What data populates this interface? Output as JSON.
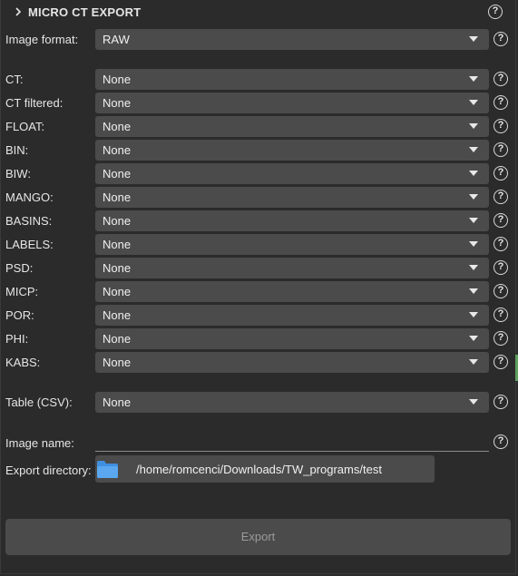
{
  "header": {
    "title": "MICRO CT EXPORT"
  },
  "image_format": {
    "label": "Image format:",
    "value": "RAW"
  },
  "volumes": [
    {
      "label": "CT:",
      "value": "None"
    },
    {
      "label": "CT filtered:",
      "value": "None"
    },
    {
      "label": "FLOAT:",
      "value": "None"
    },
    {
      "label": "BIN:",
      "value": "None"
    },
    {
      "label": "BIW:",
      "value": "None"
    },
    {
      "label": "MANGO:",
      "value": "None"
    },
    {
      "label": "BASINS:",
      "value": "None"
    },
    {
      "label": "LABELS:",
      "value": "None"
    },
    {
      "label": "PSD:",
      "value": "None"
    },
    {
      "label": "MICP:",
      "value": "None"
    },
    {
      "label": "POR:",
      "value": "None"
    },
    {
      "label": "PHI:",
      "value": "None"
    },
    {
      "label": "KABS:",
      "value": "None"
    }
  ],
  "table_csv": {
    "label": "Table (CSV):",
    "value": "None"
  },
  "image_name": {
    "label": "Image name:",
    "value": ""
  },
  "export_directory": {
    "label": "Export directory:",
    "path": "/home/romcenci/Downloads/TW_programs/test"
  },
  "export_button": {
    "label": "Export"
  },
  "icons": {
    "collapse": "chevron-right-icon",
    "help": "help-circle-icon",
    "folder": "folder-icon",
    "dropdown": "chevron-down-icon"
  },
  "colors": {
    "background": "#2b2b2b",
    "field": "#4b4b4b",
    "text": "#e6e6e6",
    "disabled_text": "#9a9a9a",
    "folder": "#3f8fe0",
    "side_accent": "#5fa05f"
  }
}
